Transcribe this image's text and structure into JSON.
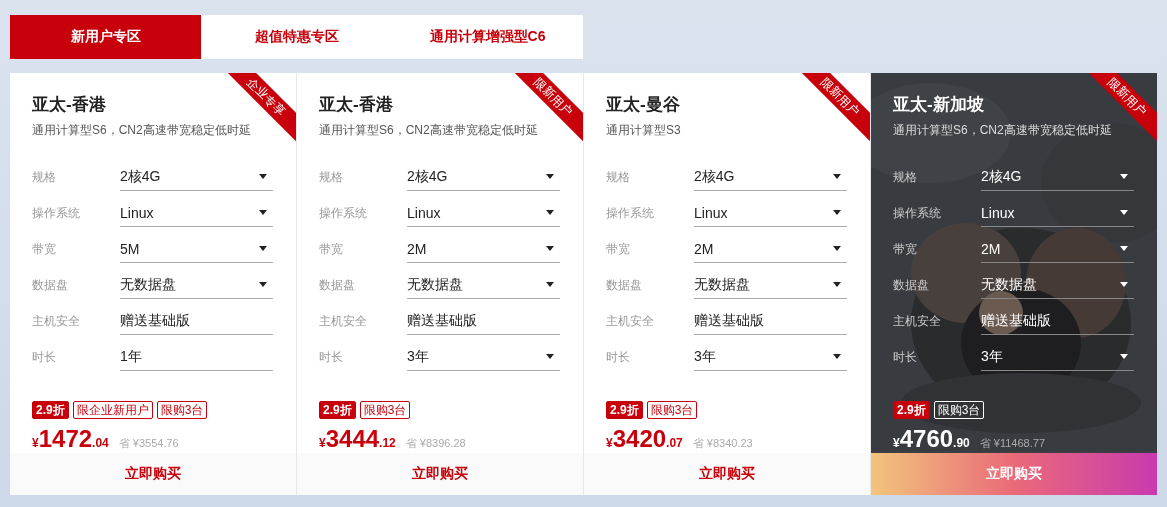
{
  "tabs": [
    {
      "label": "新用户专区",
      "selected": true
    },
    {
      "label": "超值特惠专区",
      "selected": false
    },
    {
      "label": "通用计算增强型C6",
      "selected": false
    }
  ],
  "cards": [
    {
      "ribbon": "企业专享",
      "title": "亚太-香港",
      "subtitle": "通用计算型S6，CN2高速带宽稳定低时延",
      "highlighted": false,
      "fields": [
        {
          "label": "规格",
          "value": "2核4G",
          "dropdown": true
        },
        {
          "label": "操作系统",
          "value": "Linux",
          "dropdown": true
        },
        {
          "label": "带宽",
          "value": "5M",
          "dropdown": true
        },
        {
          "label": "数据盘",
          "value": "无数据盘",
          "dropdown": true
        },
        {
          "label": "主机安全",
          "value": "赠送基础版",
          "dropdown": false
        },
        {
          "label": "时长",
          "value": "1年",
          "dropdown": false
        }
      ],
      "tags": [
        {
          "text": "2.9折",
          "kind": "solid"
        },
        {
          "text": "限企业新用户",
          "kind": "outline"
        },
        {
          "text": "限购3台",
          "kind": "outline"
        }
      ],
      "currency": "¥",
      "price": "1472",
      "cents": ".04",
      "saving": "省 ¥3554.76",
      "button": "立即购买"
    },
    {
      "ribbon": "限新用户",
      "title": "亚太-香港",
      "subtitle": "通用计算型S6，CN2高速带宽稳定低时延",
      "highlighted": false,
      "fields": [
        {
          "label": "规格",
          "value": "2核4G",
          "dropdown": true
        },
        {
          "label": "操作系统",
          "value": "Linux",
          "dropdown": true
        },
        {
          "label": "带宽",
          "value": "2M",
          "dropdown": true
        },
        {
          "label": "数据盘",
          "value": "无数据盘",
          "dropdown": true
        },
        {
          "label": "主机安全",
          "value": "赠送基础版",
          "dropdown": false
        },
        {
          "label": "时长",
          "value": "3年",
          "dropdown": true
        }
      ],
      "tags": [
        {
          "text": "2.9折",
          "kind": "solid"
        },
        {
          "text": "限购3台",
          "kind": "outline"
        }
      ],
      "currency": "¥",
      "price": "3444",
      "cents": ".12",
      "saving": "省 ¥8396.28",
      "button": "立即购买"
    },
    {
      "ribbon": "限新用户",
      "title": "亚太-曼谷",
      "subtitle": "通用计算型S3",
      "highlighted": false,
      "fields": [
        {
          "label": "规格",
          "value": "2核4G",
          "dropdown": true
        },
        {
          "label": "操作系统",
          "value": "Linux",
          "dropdown": true
        },
        {
          "label": "带宽",
          "value": "2M",
          "dropdown": true
        },
        {
          "label": "数据盘",
          "value": "无数据盘",
          "dropdown": true
        },
        {
          "label": "主机安全",
          "value": "赠送基础版",
          "dropdown": false
        },
        {
          "label": "时长",
          "value": "3年",
          "dropdown": true
        }
      ],
      "tags": [
        {
          "text": "2.9折",
          "kind": "solid"
        },
        {
          "text": "限购3台",
          "kind": "outline"
        }
      ],
      "currency": "¥",
      "price": "3420",
      "cents": ".07",
      "saving": "省 ¥8340.23",
      "button": "立即购买"
    },
    {
      "ribbon": "限新用户",
      "title": "亚太-新加坡",
      "subtitle": "通用计算型S6，CN2高速带宽稳定低时延",
      "highlighted": true,
      "fields": [
        {
          "label": "规格",
          "value": "2核4G",
          "dropdown": true
        },
        {
          "label": "操作系统",
          "value": "Linux",
          "dropdown": true
        },
        {
          "label": "带宽",
          "value": "2M",
          "dropdown": true
        },
        {
          "label": "数据盘",
          "value": "无数据盘",
          "dropdown": true
        },
        {
          "label": "主机安全",
          "value": "赠送基础版",
          "dropdown": false
        },
        {
          "label": "时长",
          "value": "3年",
          "dropdown": true
        }
      ],
      "tags": [
        {
          "text": "2.9折",
          "kind": "solid"
        },
        {
          "text": "限购3台",
          "kind": "outline"
        }
      ],
      "currency": "¥",
      "price": "4760",
      "cents": ".90",
      "saving": "省 ¥11468.77",
      "button": "立即购买"
    }
  ]
}
